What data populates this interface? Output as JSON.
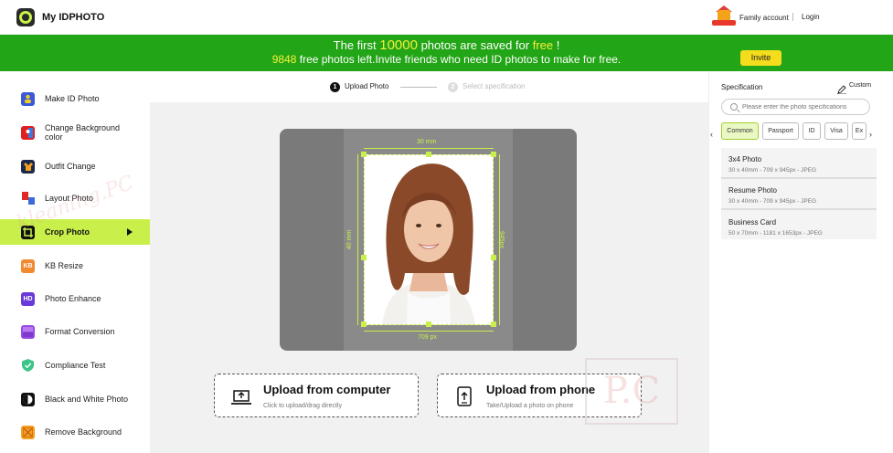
{
  "header": {
    "app_title": "My IDPHOTO",
    "family_account": "Family account",
    "login": "Login"
  },
  "banner": {
    "line1_prefix": "The first ",
    "line1_count": "10000",
    "line1_middle": " photos are saved for ",
    "line1_free": "free",
    "line1_suffix": " !",
    "line2_count": "9848",
    "line2_text": " free photos left.Invite friends who need ID photos to make for free.",
    "invite_label": "Invite"
  },
  "sidebar": {
    "items": [
      {
        "label": "Make ID Photo",
        "icon": "id-photo-icon"
      },
      {
        "label": "Change Background color",
        "icon": "background-color-icon"
      },
      {
        "label": "Outfit Change",
        "icon": "outfit-icon"
      },
      {
        "label": "Layout Photo",
        "icon": "layout-icon"
      },
      {
        "label": "Crop Photo",
        "icon": "crop-icon",
        "active": true
      },
      {
        "label": "KB Resize",
        "icon": "kb-icon",
        "badge": "KB"
      },
      {
        "label": "Photo Enhance",
        "icon": "hd-icon",
        "badge": "HD"
      },
      {
        "label": "Format Conversion",
        "icon": "format-icon"
      },
      {
        "label": "Compliance Test",
        "icon": "shield-check-icon"
      },
      {
        "label": "Black and White Photo",
        "icon": "contrast-icon"
      },
      {
        "label": "Remove Background",
        "icon": "remove-bg-icon"
      }
    ]
  },
  "steps": {
    "step1_number": "1",
    "step1_label": "Upload Photo",
    "step2_number": "2",
    "step2_label": "Select specification"
  },
  "preview": {
    "width_label": "30 mm",
    "height_label": "40 mm",
    "right_label": "945px",
    "bottom_label": "709 px"
  },
  "upload": {
    "computer_title": "Upload from computer",
    "computer_sub": "Click to upload/drag directly",
    "phone_title": "Upload from phone",
    "phone_sub": "Take/Upload a photo on phone"
  },
  "specification": {
    "title": "Specification",
    "custom_label": "Custom",
    "search_placeholder": "Please enter the photo specifications",
    "tabs": [
      "Common",
      "Passport",
      "ID",
      "Visa",
      "Ex"
    ],
    "items": [
      {
        "name": "3x4 Photo",
        "dims": "30 x 40mm - 709 x 945px - JPEG"
      },
      {
        "name": "Resume Photo",
        "dims": "30 x 40mm - 709 x 945px - JPEG"
      },
      {
        "name": "Business Card",
        "dims": "50 x 70mm - 1181 x 1653px - JPEG"
      }
    ]
  },
  "colors": {
    "accent": "#c8ef4a",
    "banner": "#22a516",
    "highlight": "#f6f03a",
    "invite": "#f5dc1c"
  }
}
